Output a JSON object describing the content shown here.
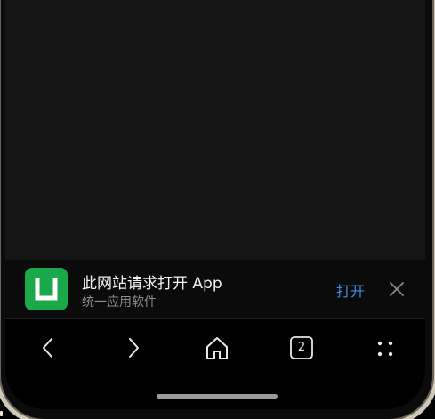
{
  "banner": {
    "title": "此网站请求打开 App",
    "subtitle": "统一应用软件",
    "open_label": "打开",
    "close_icon": "close-icon",
    "app_icon": "unified-app-logo-icon",
    "accent_color": "#3d8fe6",
    "app_icon_color": "#1aa84a"
  },
  "navbar": {
    "back_icon": "chevron-left-icon",
    "forward_icon": "chevron-right-icon",
    "home_icon": "home-icon",
    "tabs_icon": "tabs-icon",
    "tabs_count": "2",
    "menu_icon": "four-dots-menu-icon"
  }
}
